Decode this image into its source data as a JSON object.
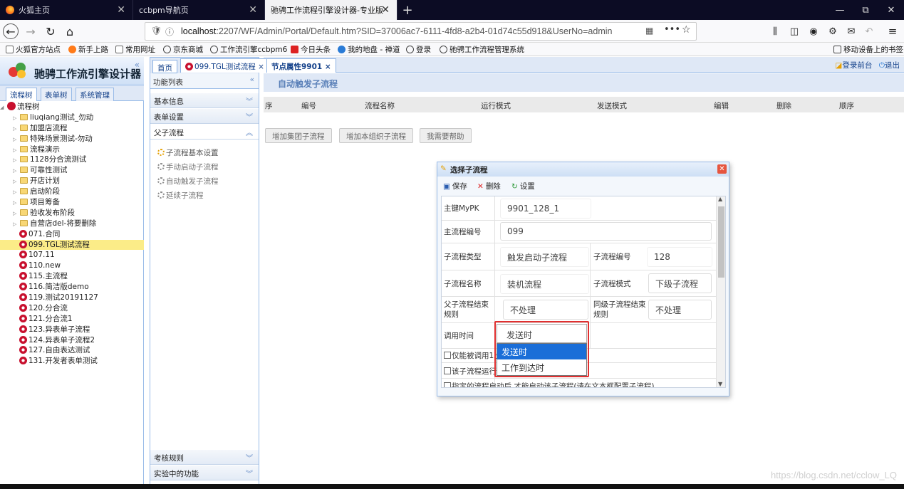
{
  "browser": {
    "tabs": [
      {
        "label": "火狐主页",
        "close": "✕"
      },
      {
        "label": "ccbpm导航页",
        "close": "✕"
      },
      {
        "label": "驰骋工作流程引擎设计器-专业版",
        "close": "✕"
      }
    ],
    "new_tab": "+",
    "window_controls": [
      "—",
      "⧉",
      "✕"
    ],
    "url_host": "localhost",
    "url_rest": ":2207/WF/Admin/Portal/Default.htm?SID=37006ac7-6111-4fd8-a2b4-01d74c55d918&UserNo=admin",
    "bookmarks": [
      "火狐官方站点",
      "新手上路",
      "常用网址",
      "京东商城",
      "工作流引擎ccbpm6",
      "今日头条",
      "我的地盘 - 禅道",
      "登录",
      "驰骋工作流程管理系统"
    ],
    "mobile_bookmarks": "移动设备上的书签"
  },
  "app": {
    "logo_title": "驰骋工作流引擎设计器",
    "left_tabs": [
      "流程树",
      "表单树",
      "系统管理"
    ],
    "tree_root": "流程树",
    "tree_folders": [
      "liuqiang测试_勿动",
      "加盟店流程",
      "特殊场景测试-勿动",
      "流程演示",
      "1128分合流测试",
      "可靠性测试",
      "开店计划",
      "启动阶段",
      "项目筹备",
      "验收发布阶段",
      "自营店del-将要删除"
    ],
    "tree_flows": [
      "071.合同",
      "099.TGL测试流程",
      "107.11",
      "110.new",
      "115.主流程",
      "116.简洁版demo",
      "119.测试20191127",
      "120.分合流",
      "121.分合流1",
      "123.异表单子流程",
      "124.异表单子流程2",
      "127.自由表达测试",
      "131.开发者表单测试"
    ],
    "selected_flow_index": 1,
    "mid_tabs": [
      "首页",
      "099.TGL测试流程 ×"
    ],
    "mid_title": "功能列表",
    "accordions": [
      "基本信息",
      "表单设置",
      "父子流程"
    ],
    "sub_items": [
      "子流程基本设置",
      "手动启动子流程",
      "自动触发子流程",
      "延续子流程"
    ],
    "bottom_accordions": [
      "考核规则",
      "实验中的功能"
    ],
    "right_tab": "节点属性9901 ×",
    "top_links": [
      "登录前台",
      "退出"
    ],
    "content_title": "自动触发子流程",
    "table_headers": [
      "序",
      "编号",
      "流程名称",
      "运行模式",
      "发送模式",
      "编辑",
      "删除",
      "顺序"
    ],
    "buttons": [
      "增加集团子流程",
      "增加本组织子流程",
      "我需要帮助"
    ]
  },
  "dialog": {
    "title": "选择子流程",
    "close": "✕",
    "toolbar": [
      "保存",
      "删除",
      "设置"
    ],
    "fields": {
      "mypk_label": "主键MyPK",
      "mypk_value": "9901_128_1",
      "main_flow_no_label": "主流程编号",
      "main_flow_no_value": "099",
      "sub_type_label": "子流程类型",
      "sub_type_value": "触发启动子流程",
      "sub_no_label": "子流程编号",
      "sub_no_value": "128",
      "sub_name_label": "子流程名称",
      "sub_name_value": "装机流程",
      "sub_mode_label": "子流程模式",
      "sub_mode_value": "下级子流程",
      "parent_end_label": "父子流程结束规则",
      "parent_end_value": "不处理",
      "sibling_end_label": "同级子流程结束规则",
      "sibling_end_value": "不处理",
      "call_time_label": "调用时间",
      "call_time_value": "发送时",
      "check1": "仅能被调用1次",
      "check2": "该子流程运行",
      "check3": "指定的流程启动后,才能启动该子流程(请在文本框配置子流程)"
    },
    "dropdown_options": [
      "发送时",
      "工作到达时"
    ],
    "dropdown_highlighted": 0
  },
  "watermark": "https://blog.csdn.net/cclow_LQ",
  "colors": {
    "accent": "#15428b",
    "highlight": "#1a6ed8",
    "selection": "#fbec88",
    "red_box": "#e03030"
  }
}
